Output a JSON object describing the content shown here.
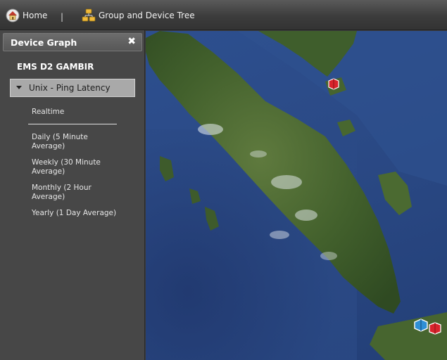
{
  "toolbar": {
    "home_label": "Home",
    "separator": "|",
    "tree_label": "Group and Device Tree"
  },
  "panel": {
    "title": "Device Graph",
    "close_symbol": "✖",
    "device_name": "EMS D2 GAMBIR",
    "selected_graph": "Unix - Ping Latency",
    "menu": {
      "realtime": "Realtime",
      "daily": "Daily (5 Minute Average)",
      "weekly": "Weekly (30 Minute Average)",
      "monthly": "Monthly (2 Hour Average)",
      "yearly": "Yearly (1 Day Average)"
    }
  },
  "icons": {
    "home": "home-icon",
    "tree": "group-tree-icon",
    "markers": [
      "device-marker-red-icon",
      "device-marker-blue-icon",
      "device-marker-red-icon"
    ]
  },
  "colors": {
    "toolbar_bg": "#3c3c3c",
    "panel_bg": "#474747",
    "dropdown_bg": "#a9a9a9",
    "ocean": "#2b4a86",
    "marker_red": "#d8242c",
    "marker_blue": "#2f8fd6"
  }
}
